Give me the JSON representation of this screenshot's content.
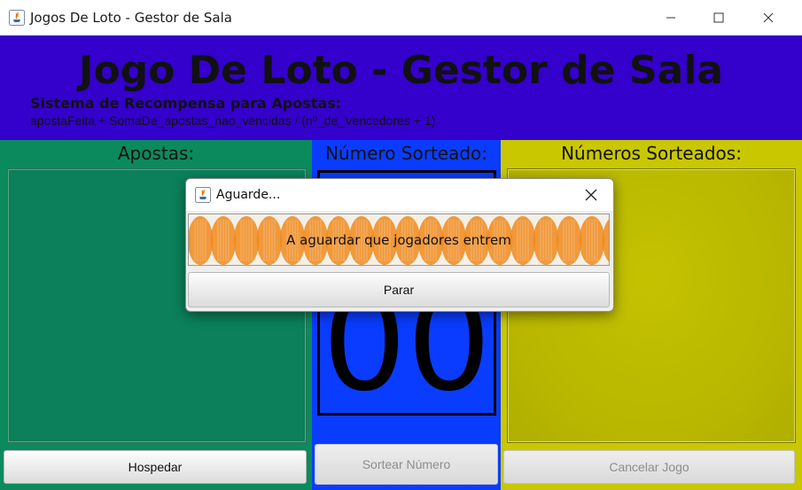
{
  "window": {
    "title": "Jogos De Loto - Gestor de Sala",
    "controls": [
      "minimize-icon",
      "maximize-icon",
      "close-icon"
    ]
  },
  "header": {
    "title": "Jogo De Loto - Gestor de Sala",
    "reward_title": "Sistema de Recompensa para Apostas:",
    "reward_formula": "apostaFeita + SomaDe_apostas_nao_vencidas / (nº_de_Vencedores + 1)",
    "background": "#3300cc"
  },
  "panels": {
    "apostas": {
      "label": "Apostas:",
      "color": "#0b8a5e",
      "button": "Hospedar",
      "button_enabled": true
    },
    "numero": {
      "label": "Número Sorteado:",
      "color": "#0a3cff",
      "value": "00",
      "button": "Sortear Número",
      "button_enabled": false
    },
    "sorteados": {
      "label": "Números Sorteados:",
      "color": "#c9c700",
      "button": "Cancelar Jogo",
      "button_enabled": false
    }
  },
  "dialog": {
    "title": "Aguarde...",
    "progress_text": "A aguardar que jogadores entrem",
    "progress_color": "#f08a1c",
    "button": "Parar",
    "icons": [
      "java-icon",
      "close-icon"
    ]
  }
}
